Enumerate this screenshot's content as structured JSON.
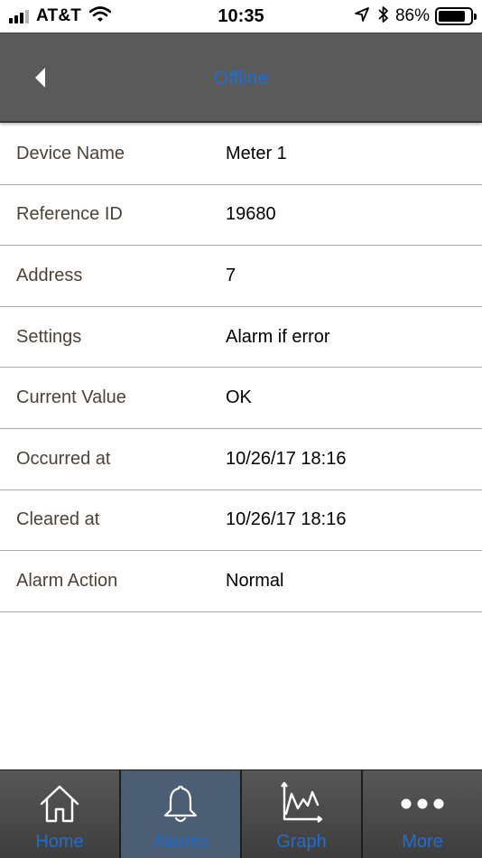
{
  "status_bar": {
    "carrier": "AT&T",
    "time": "10:35",
    "battery_percent": "86%",
    "battery_level": 0.86,
    "icons": [
      "signal-icon",
      "wifi-icon",
      "location-arrow-icon",
      "bluetooth-icon",
      "battery-icon"
    ]
  },
  "header": {
    "title": "Offline",
    "title_color": "#1e6fd0",
    "background_color": "#5a5a5a",
    "back_icon": "back-arrow-icon"
  },
  "details": [
    {
      "label": "Device Name",
      "value": "Meter 1"
    },
    {
      "label": "Reference ID",
      "value": "19680"
    },
    {
      "label": "Address",
      "value": "7"
    },
    {
      "label": "Settings",
      "value": "Alarm if error"
    },
    {
      "label": "Current Value",
      "value": "OK"
    },
    {
      "label": "Occurred at",
      "value": "10/26/17 18:16"
    },
    {
      "label": "Cleared at",
      "value": "10/26/17 18:16"
    },
    {
      "label": "Alarm Action",
      "value": "Normal"
    }
  ],
  "tab_bar": {
    "active_tab": "Alarms",
    "tabs": [
      {
        "label": "Home",
        "icon": "home-icon"
      },
      {
        "label": "Alarms",
        "icon": "bell-icon"
      },
      {
        "label": "Graph",
        "icon": "graph-icon"
      },
      {
        "label": "More",
        "icon": "more-dots-icon"
      }
    ],
    "label_color": "#1e6fd0",
    "active_background": "#4b5e74"
  }
}
